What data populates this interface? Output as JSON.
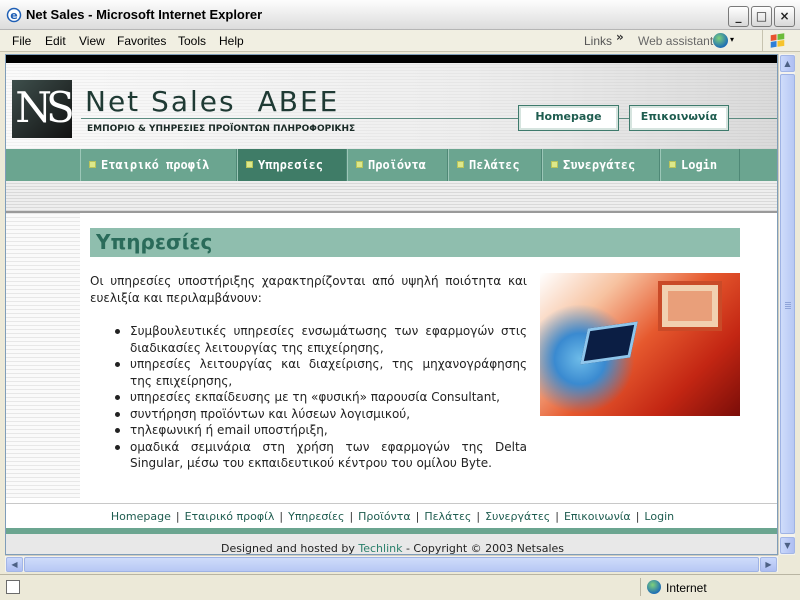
{
  "window": {
    "title": "Net Sales - Microsoft Internet Explorer",
    "controls": {
      "minimize": "_",
      "maximize": "□",
      "close": "×"
    }
  },
  "menubar": {
    "items": [
      "File",
      "Edit",
      "View",
      "Favorites",
      "Tools",
      "Help"
    ],
    "links_label": "Links",
    "links_chevron": "»",
    "web_assistant": "Web assistant",
    "web_assistant_dropdown": "▾"
  },
  "site": {
    "logo_text": "NS",
    "brand": "Net Sales",
    "brand_suffix": "ABEE",
    "tagline": "ΕΜΠΟΡΙΟ & ΥΠΗΡΕΣΙΕΣ ΠΡΟΪΟΝΤΩΝ ΠΛΗΡΟΦΟΡΙΚΗΣ",
    "header_buttons": {
      "homepage": "Homepage",
      "contact": "Επικοινωνία"
    },
    "nav": [
      {
        "label": "Εταιρικό προφίλ",
        "active": false
      },
      {
        "label": "Υπηρεσίες",
        "active": true
      },
      {
        "label": "Προϊόντα",
        "active": false
      },
      {
        "label": "Πελάτες",
        "active": false
      },
      {
        "label": "Συνεργάτες",
        "active": false
      },
      {
        "label": "Login",
        "active": false
      }
    ]
  },
  "content": {
    "title": "Υπηρεσίες",
    "intro": "Οι υπηρεσίες υποστήριξης χαρακτηρίζονται από υψηλή ποιότητα και ευελιξία και περιλαμβάνουν:",
    "services": [
      "Συμβουλευτικές υπηρεσίες ενσωμάτωσης των εφαρμογών στις διαδικασίες λειτουργίας της επιχείρησης,",
      "υπηρεσίες λειτουργίας και διαχείρισης, της μηχανογράφησης της επιχείρησης,",
      "υπηρεσίες εκπαίδευσης με τη «φυσική» παρουσία Consultant,",
      "συντήρηση προϊόντων και λύσεων λογισμικού,",
      "τηλεφωνική ή email υποστήριξη,",
      "ομαδικά σεμινάρια στη χρήση των εφαρμογών της Delta Singular, μέσω του εκπαιδευτικού κέντρου του ομίλου Byte."
    ]
  },
  "footer": {
    "links": [
      "Homepage",
      "Εταιρικό προφίλ",
      "Υπηρεσίες",
      "Προϊόντα",
      "Πελάτες",
      "Συνεργάτες",
      "Επικοινωνία",
      "Login"
    ],
    "separator": "|",
    "copyright_prefix": "Designed and hosted by",
    "copyright_link": "Techlink",
    "copyright_suffix": "- Copyright © 2003 Netsales"
  },
  "statusbar": {
    "zone": "Internet"
  },
  "colors": {
    "nav": "#6ba590",
    "nav_active": "#3f7c67",
    "title_band": "#8fbeae",
    "accent_text": "#2a6b5a"
  }
}
